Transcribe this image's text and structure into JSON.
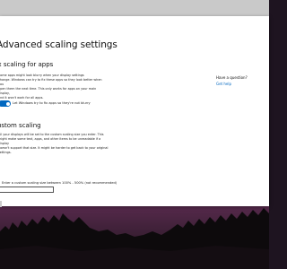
{
  "window": {
    "title": "Advanced scaling settings"
  },
  "fix_apps": {
    "heading": "Fix scaling for apps",
    "description": "Some apps might look blurry when your display settings\nchange. Windows can try to fix these apps so they look better when you\nopen them the next time. This only works for apps on your main display,\nand it won't work for all apps.",
    "toggle_label": "Let Windows try to fix apps so they're not blurry",
    "toggle_state": "On"
  },
  "custom_scaling": {
    "heading": "Custom scaling",
    "description": "All your displays will be set to the custom scaling size you enter. This\nmight make some text, apps, and other items to be unreadable if a display\ndoesn't support that size. It might be harder to get back to your original\nsettings.",
    "field_label": "Enter a custom scaling size between 100% - 500% (not recommended)",
    "field_value": ""
  },
  "aside": {
    "question": "Have a question?",
    "link": "Get help"
  },
  "colors": {
    "accent": "#0067c0",
    "wallpaper_top": "#ff7fa8",
    "wallpaper_bottom": "#1a1319"
  }
}
